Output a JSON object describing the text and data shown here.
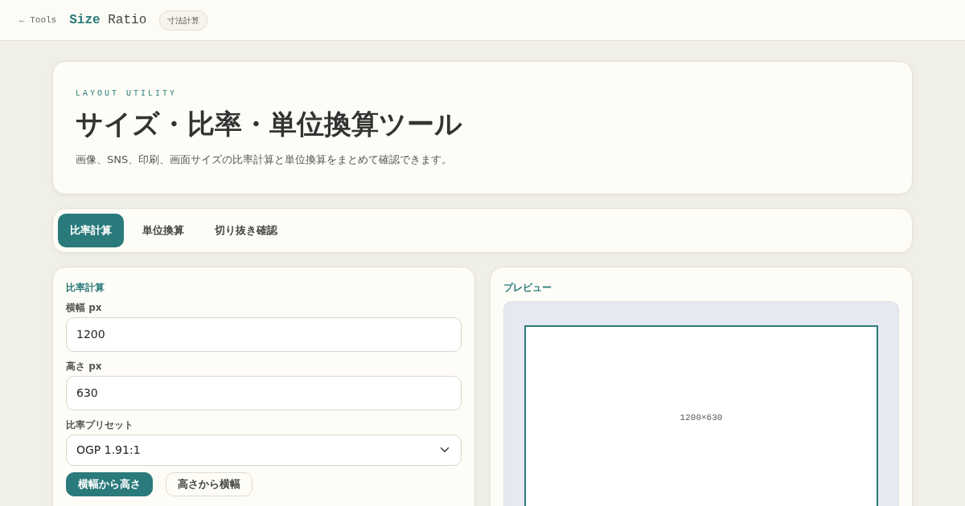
{
  "header": {
    "back_link": "← Tools",
    "brand_bold": "Size",
    "brand_rest": "Ratio",
    "badge": "寸法計算"
  },
  "hero": {
    "eyebrow": "LAYOUT UTILITY",
    "title": "サイズ・比率・単位換算ツール",
    "description": "画像、SNS、印刷、画面サイズの比率計算と単位換算をまとめて確認できます。"
  },
  "tabs": [
    {
      "label": "比率計算",
      "selected": true
    },
    {
      "label": "単位換算",
      "selected": false
    },
    {
      "label": "切り抜き確認",
      "selected": false
    }
  ],
  "ratio_panel": {
    "title": "比率計算",
    "fields": [
      {
        "label": "横幅 px",
        "value": "1200"
      },
      {
        "label": "高さ px",
        "value": "630"
      }
    ],
    "preset": {
      "label": "比率プリセット",
      "value": "OGP 1.91:1"
    },
    "buttons": [
      {
        "label": "横幅から高さ",
        "primary": true
      },
      {
        "label": "高さから横幅",
        "primary": false
      }
    ]
  },
  "preview_panel": {
    "title": "プレビュー",
    "frame_label": "1200×630"
  }
}
